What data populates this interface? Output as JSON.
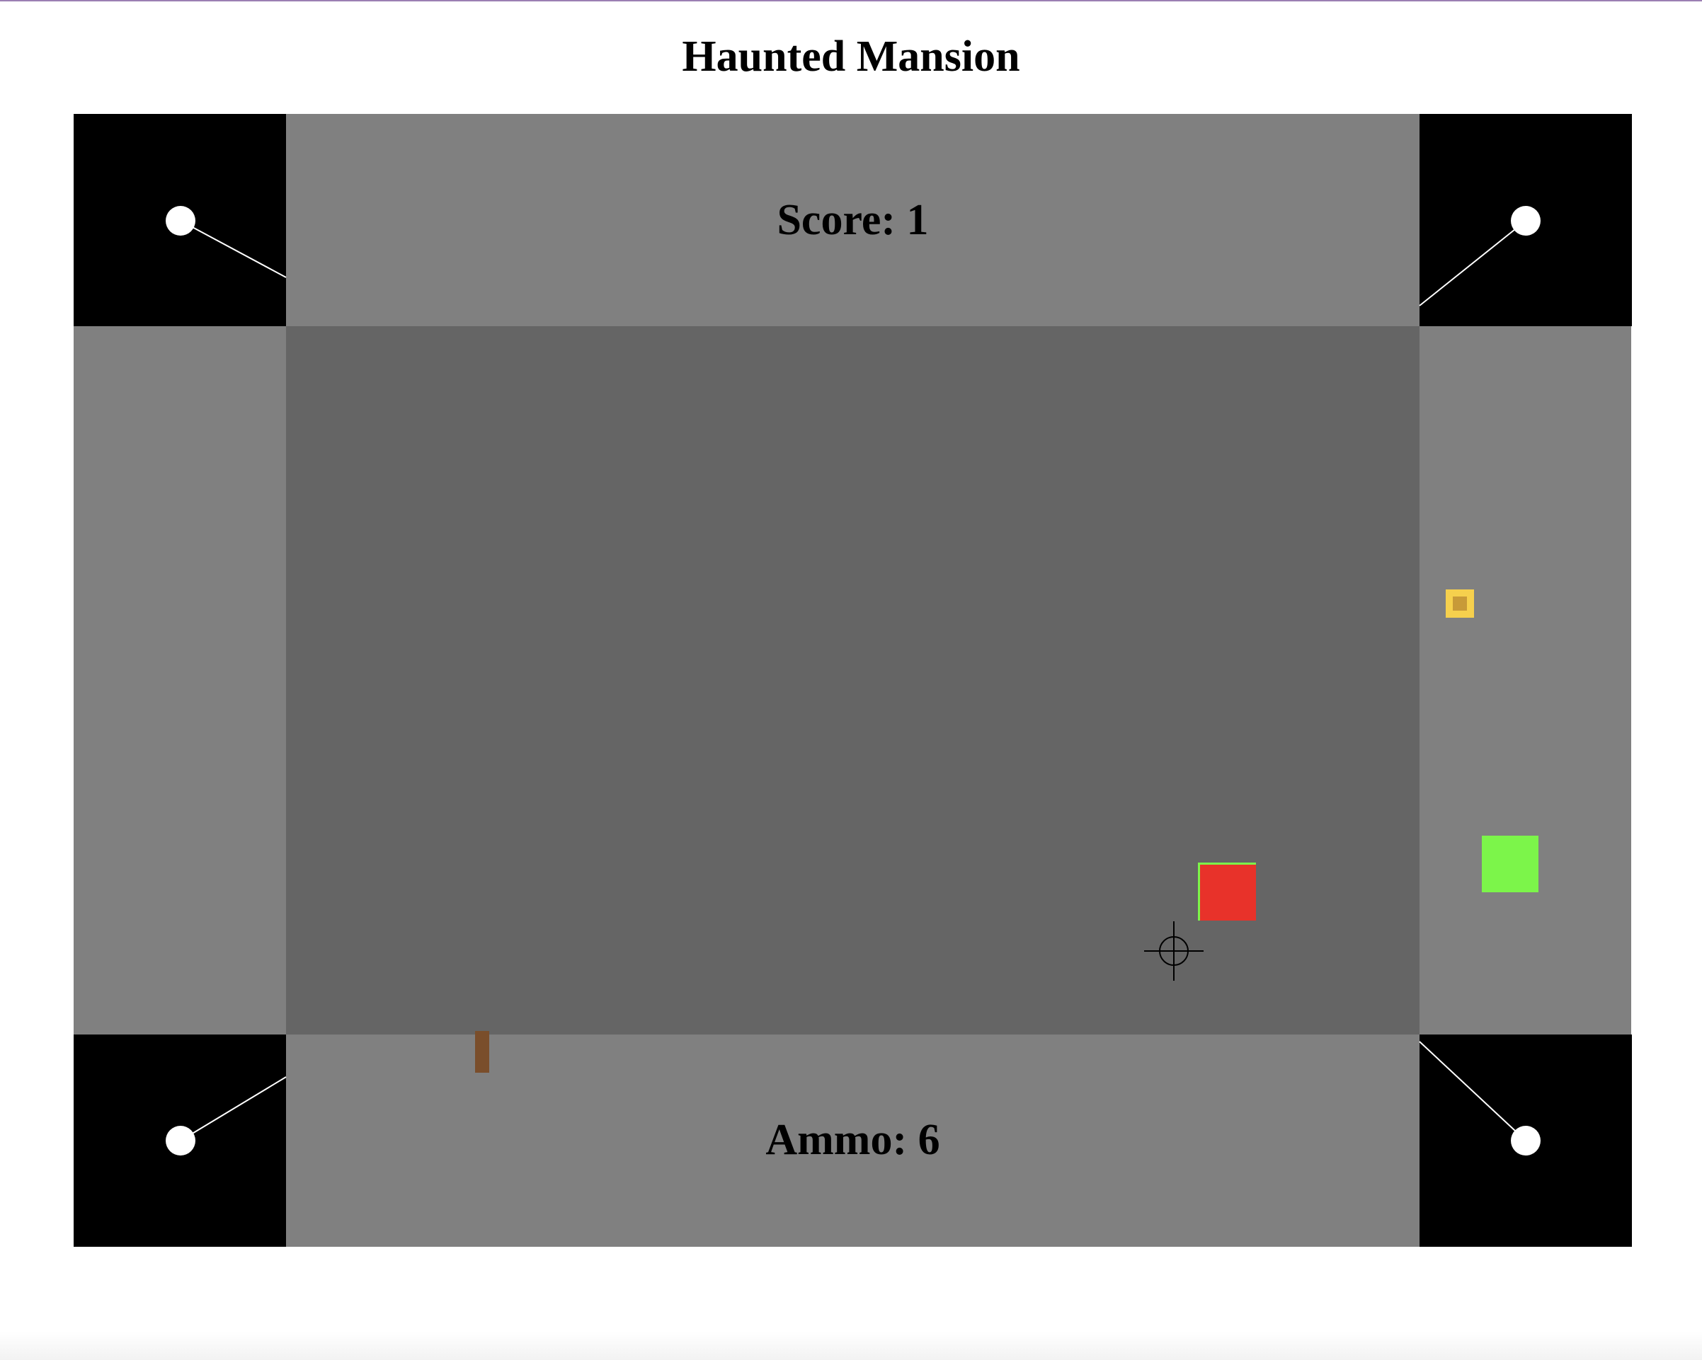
{
  "page": {
    "title": "Haunted Mansion"
  },
  "hud": {
    "score_label": "Score: ",
    "score": 1,
    "ammo_label": "Ammo: ",
    "ammo": 6
  },
  "icons": {
    "crosshair": "crosshair-icon",
    "corner_light": "lamp-icon"
  },
  "colors": {
    "board": "#808080",
    "play_area": "#656565",
    "corners": "#000000",
    "enemy": "#e8322a",
    "player": "#7cf54a",
    "ammo_pickup": "#f6d04d",
    "brown_item": "#7a4e2b"
  }
}
